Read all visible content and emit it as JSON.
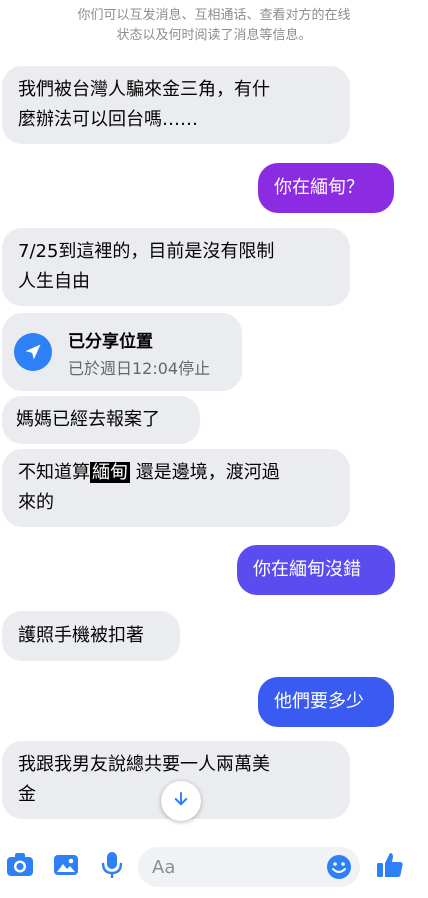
{
  "system_notice": {
    "line1": "你们可以互发消息、互相通话、查看对方的在线",
    "line2": "状态以及何时阅读了消息等信息。"
  },
  "messages": {
    "m1_line1": "我們被台灣人騙來金三角，有什",
    "m1_line2": "麼辦法可以回台嗎……",
    "m2": "你在緬甸？",
    "m3_line1": "7/25到這裡的，目前是沒有限制",
    "m3_line2": "人生自由",
    "location_title": "已分享位置",
    "location_subtitle": "已於週日12:04停止",
    "m4": "媽媽已經去報案了",
    "m5_pre": "不知道算",
    "m5_highlight": "緬甸",
    "m5_post": " 還是邊境，渡河過",
    "m5_line2": "來的",
    "m6": "你在緬甸沒錯",
    "m7": "護照手機被扣著",
    "m8": "他們要多少",
    "m9_line1": "我跟我男友說總共要一人兩萬美",
    "m9_line2": "金"
  },
  "composer": {
    "placeholder": "Aa"
  },
  "colors": {
    "out_purple": "#8b2be2",
    "out_indigo": "#5b4cf0",
    "out_blue": "#3a5bf2",
    "in_bg": "#eaecef",
    "accent": "#2d80f5"
  },
  "icons": [
    "camera-icon",
    "image-icon",
    "microphone-icon",
    "emoji-icon",
    "thumbs-up-icon",
    "arrow-down-icon",
    "location-arrow-icon"
  ]
}
